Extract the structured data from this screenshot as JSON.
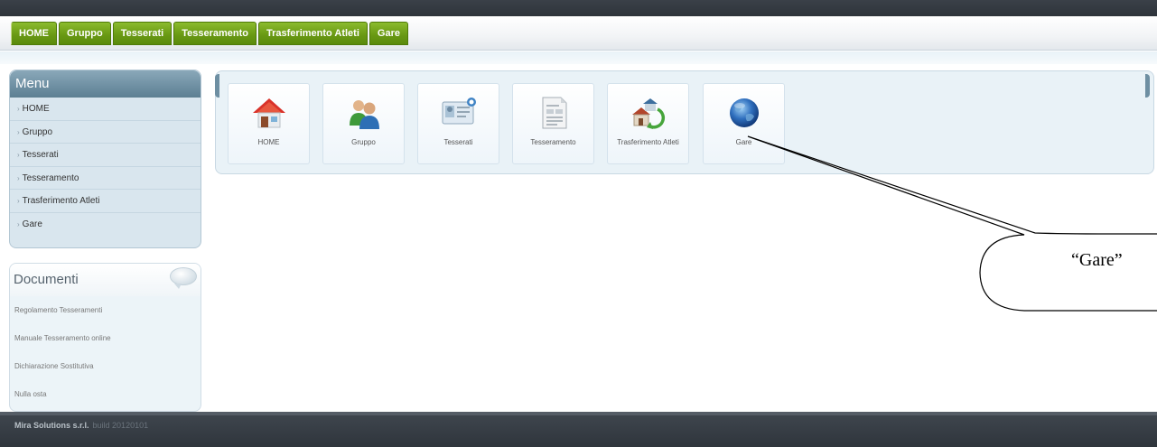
{
  "nav": {
    "tabs": [
      "HOME",
      "Gruppo",
      "Tesserati",
      "Tesseramento",
      "Trasferimento Atleti",
      "Gare"
    ]
  },
  "menu": {
    "title": "Menu",
    "items": [
      "HOME",
      "Gruppo",
      "Tesserati",
      "Tesseramento",
      "Trasferimento Atleti",
      "Gare"
    ]
  },
  "documenti": {
    "title": "Documenti",
    "items": [
      "Regolamento Tesseramenti",
      "Manuale Tesseramento online",
      "Dichiarazione Sostitutiva",
      "Nulla osta"
    ]
  },
  "icon_panel": {
    "tiles": [
      {
        "label": "HOME",
        "icon": "house-icon"
      },
      {
        "label": "Gruppo",
        "icon": "people-icon"
      },
      {
        "label": "Tesserati",
        "icon": "id-card-icon"
      },
      {
        "label": "Tesseramento",
        "icon": "document-icon"
      },
      {
        "label": "Trasferimento Atleti",
        "icon": "house-transfer-icon"
      },
      {
        "label": "Gare",
        "icon": "globe-icon"
      }
    ]
  },
  "footer": {
    "company": "Mira Solutions s.r.l.",
    "build": "build 20120101"
  },
  "callout": {
    "text": "“Gare”"
  },
  "colors": {
    "nav_tab": "#6a9a14",
    "menu_header": "#6e8fa2",
    "footer": "#2f353c"
  }
}
